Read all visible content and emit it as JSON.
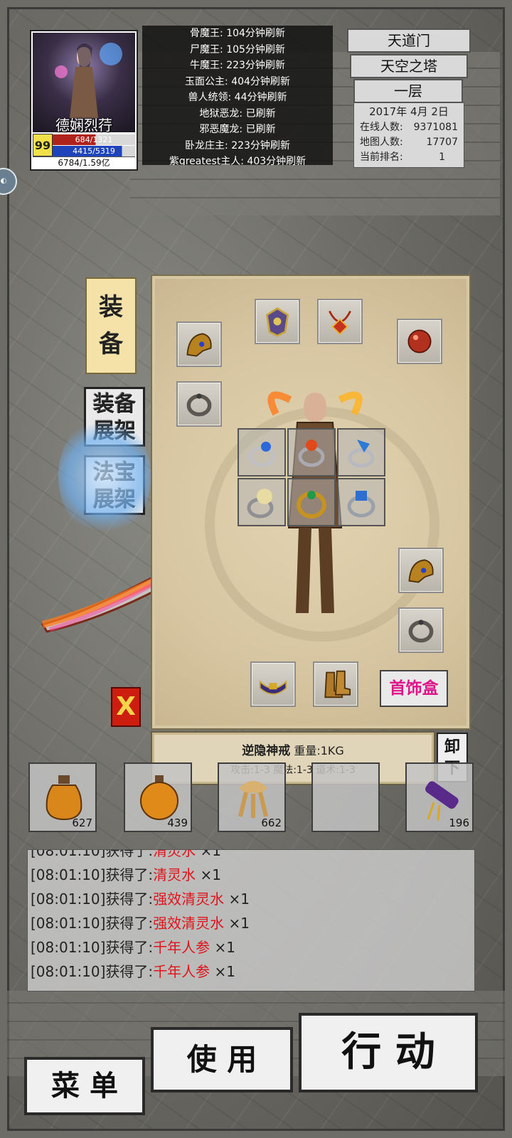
{
  "player": {
    "name": "德娴烈荇",
    "level": "99",
    "hp": "684",
    "hp_max": "1321",
    "mp": "4415",
    "mp_max": "5319",
    "exp": "6784/1.59亿"
  },
  "boss_refresh": [
    "骨魔王: 104分钟刷新",
    "尸魔王: 105分钟刷新",
    "牛魔王: 223分钟刷新",
    "玉面公主: 404分钟刷新",
    "兽人统领: 44分钟刷新",
    "地狱恶龙: 已刷新",
    "邪恶魔龙: 已刷新",
    "卧龙庄主: 223分钟刷新",
    "紫greatest主人: 403分钟刷新"
  ],
  "location": {
    "sect": "天道门",
    "map": "天空之塔",
    "floor": "一层"
  },
  "server_info": {
    "date": "2017年 4月 2日",
    "online_label": "在线人数:",
    "online_value": "9371081",
    "map_label": "地图人数:",
    "map_value": "17707",
    "rank_label": "当前排名:",
    "rank_value": "1"
  },
  "side_buttons": {
    "equip_tab_1": "装",
    "equip_tab_2": "备",
    "equip_shelf_1": "装备",
    "equip_shelf_2": "展架",
    "treasure_shelf_1": "法宝",
    "treasure_shelf_2": "展架",
    "close": "X"
  },
  "equipment_panel": {
    "jewelry_box_label": "首饰盒",
    "slots": [
      "helmet-icon",
      "necklace-icon",
      "orb-icon",
      "bracelet-icon",
      "ring-icon",
      "belt-icon",
      "boots-icon"
    ],
    "ring_grid": [
      "ring-icon",
      "ring-icon",
      "ring-icon",
      "ring-icon",
      "ring-icon",
      "ring-icon"
    ]
  },
  "item_tooltip": {
    "name": "逆隐神戒",
    "weight": "重量:1KG",
    "stats": "攻击:1-3 魔法:1-3 道术:1-3"
  },
  "unequip_button": {
    "line1": "卸",
    "line2": "下"
  },
  "items": [
    {
      "icon": "potion-icon",
      "count": "627"
    },
    {
      "icon": "potion-icon",
      "count": "439"
    },
    {
      "icon": "ginseng-icon",
      "count": "662"
    },
    {
      "icon": "empty",
      "count": ""
    },
    {
      "icon": "scroll-icon",
      "count": "196"
    }
  ],
  "log": [
    {
      "time": "[08:01:10]",
      "verb": "获得了:",
      "item": "清灵水",
      "qty": " ×1"
    },
    {
      "time": "[08:01:10]",
      "verb": "获得了:",
      "item": "清灵水",
      "qty": " ×1"
    },
    {
      "time": "[08:01:10]",
      "verb": "获得了:",
      "item": "强效清灵水",
      "qty": " ×1"
    },
    {
      "time": "[08:01:10]",
      "verb": "获得了:",
      "item": "强效清灵水",
      "qty": " ×1"
    },
    {
      "time": "[08:01:10]",
      "verb": "获得了:",
      "item": "千年人参",
      "qty": " ×1"
    },
    {
      "time": "[08:01:10]",
      "verb": "获得了:",
      "item": "千年人参",
      "qty": " ×1"
    }
  ],
  "bottom_buttons": {
    "menu": "菜 单",
    "use": "使 用",
    "action": "行 动"
  },
  "colors": {
    "loot_text": "#e0141a",
    "jewelry_text": "#e0158b",
    "close_bg": "#cc1d0e"
  }
}
